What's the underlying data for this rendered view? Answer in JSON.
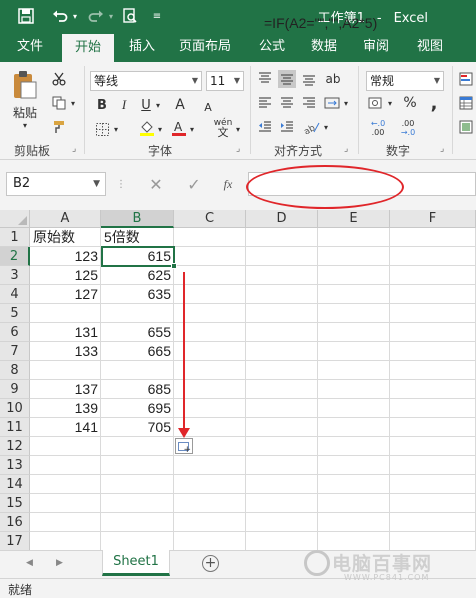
{
  "window": {
    "title": "工作簿1",
    "app": "Excel"
  },
  "qat": [
    "save-icon",
    "undo-icon",
    "redo-icon",
    "print-preview-icon",
    "customize-icon"
  ],
  "tabs": [
    "文件",
    "开始",
    "插入",
    "页面布局",
    "公式",
    "数据",
    "审阅",
    "视图"
  ],
  "active_tab": "开始",
  "ribbon": {
    "clipboard": {
      "paste_label": "粘贴",
      "group_label": "剪贴板"
    },
    "font": {
      "font_name": "等线",
      "font_size": "11",
      "group_label": "字体"
    },
    "alignment": {
      "group_label": "对齐方式"
    },
    "number": {
      "format": "常规",
      "group_label": "数字"
    }
  },
  "formula_bar": {
    "name_box": "B2",
    "fx_label": "fx",
    "formula": "=IF(A2=\"\",\"\",A2*5)"
  },
  "columns": [
    "A",
    "B",
    "C",
    "D",
    "E",
    "F"
  ],
  "selected_column": "B",
  "rows": [
    "1",
    "2",
    "3",
    "4",
    "5",
    "6",
    "7",
    "8",
    "9",
    "10",
    "11",
    "12",
    "13",
    "14",
    "15",
    "16",
    "17"
  ],
  "selected_row": "2",
  "cells": {
    "A1": "原始数",
    "B1": "5倍数",
    "A2": "123",
    "B2": "615",
    "A3": "125",
    "B3": "625",
    "A4": "127",
    "B4": "635",
    "A6": "131",
    "B6": "655",
    "A7": "133",
    "B7": "665",
    "A9": "137",
    "B9": "685",
    "A10": "139",
    "B10": "695",
    "A11": "141",
    "B11": "705"
  },
  "sheet_tabs": [
    "Sheet1"
  ],
  "status": "就绪",
  "watermark": {
    "text": "电脑百事网",
    "sub": "WWW.PC841.COM"
  },
  "colors": {
    "accent": "#217346",
    "annotation": "#e0262a"
  }
}
